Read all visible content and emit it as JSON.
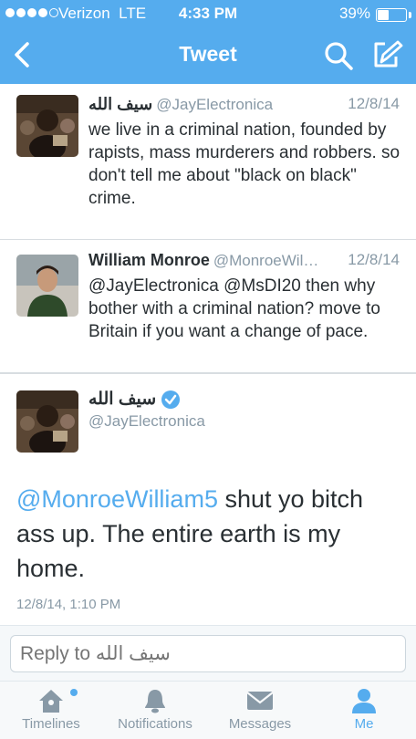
{
  "status_bar": {
    "carrier": "Verizon",
    "network": "LTE",
    "time": "4:33 PM",
    "battery_percent": "39%",
    "battery_level": 0.39,
    "signal_bars": 4
  },
  "nav": {
    "title": "Tweet",
    "icons": [
      "back-chevron-icon",
      "search-icon",
      "compose-icon"
    ]
  },
  "tweets": [
    {
      "name": "سيف الله",
      "handle": "@JayElectronica",
      "date": "12/8/14",
      "text": "we live in a criminal nation, founded by rapists, mass murderers and robbers. so don't tell me about \"black on black\" crime."
    },
    {
      "name": "William Monroe",
      "handle": "@MonroeWil…",
      "date": "12/8/14",
      "text": "@JayElectronica @MsDI20 then why bother with a criminal nation? move to Britain if you want a change of pace."
    }
  ],
  "main_tweet": {
    "name": "سيف الله",
    "verified": true,
    "handle": "@JayElectronica",
    "mention": "@MonroeWilliam5",
    "text_rest": " shut yo bitch ass up. The entire earth is my home.",
    "timestamp": "12/8/14, 1:10 PM"
  },
  "reply": {
    "placeholder": "Reply to سيف الله"
  },
  "tabs": [
    {
      "label": "Timelines",
      "icon": "home-icon",
      "has_notification_dot": true
    },
    {
      "label": "Notifications",
      "icon": "bell-icon"
    },
    {
      "label": "Messages",
      "icon": "envelope-icon"
    },
    {
      "label": "Me",
      "icon": "person-icon",
      "active": true
    }
  ],
  "colors": {
    "brand_blue": "#55acee",
    "text_dark": "#292f33",
    "text_gray": "#8899a6"
  }
}
